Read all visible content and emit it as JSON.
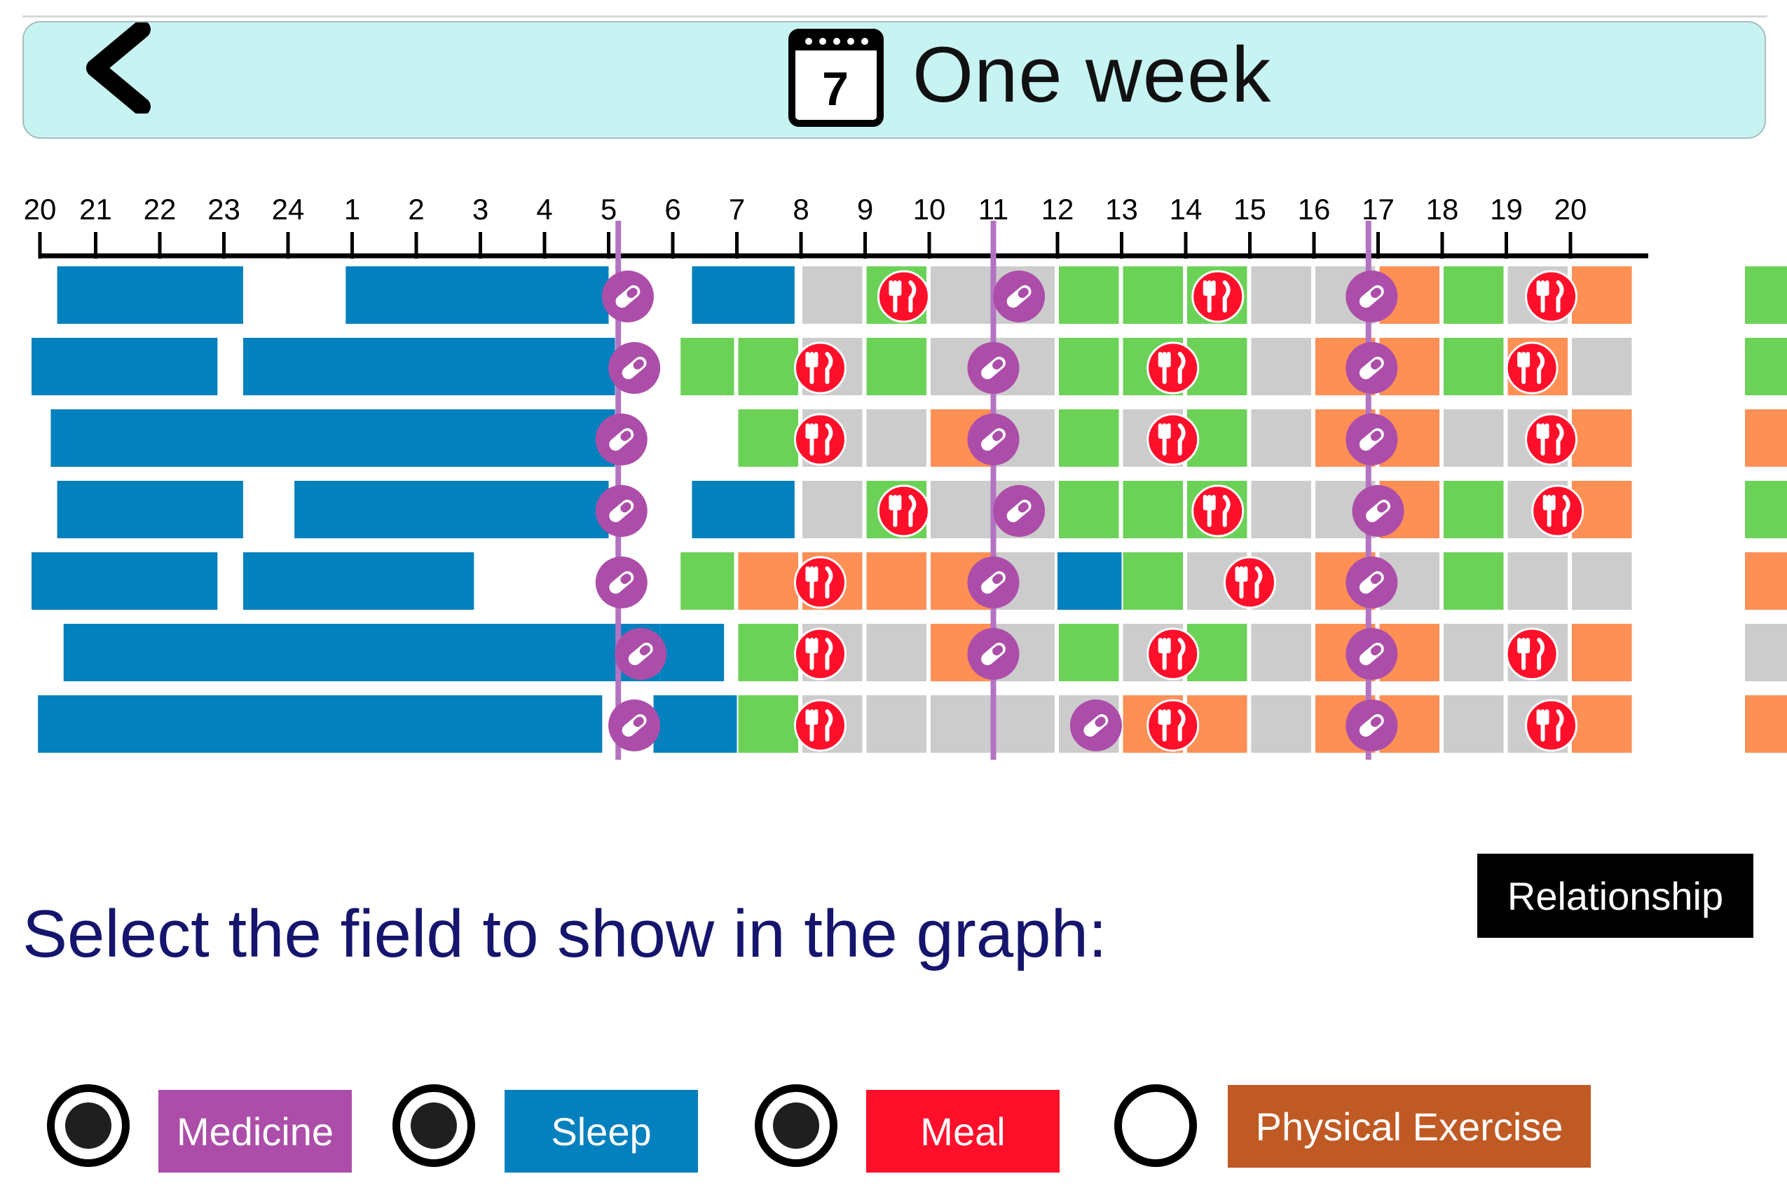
{
  "header": {
    "title": "One week",
    "calendar_day": "7"
  },
  "colors": {
    "sleep": "#0380be",
    "light": "#6bd257",
    "moderate": "#cccccc",
    "exercise": "#fe8f55",
    "medicine": "#ac4ea9",
    "meal": "#ff0f2a",
    "grid": "#000000"
  },
  "chart_data": {
    "type": "timeline",
    "x_ticks": [
      "20",
      "21",
      "22",
      "23",
      "24",
      "1",
      "2",
      "3",
      "4",
      "5",
      "6",
      "7",
      "8",
      "9",
      "10",
      "11",
      "12",
      "13",
      "14",
      "15",
      "16",
      "17",
      "18",
      "19",
      "20"
    ],
    "x_tick_hours": [
      20,
      21,
      22,
      23,
      24,
      25,
      26,
      27,
      28,
      29,
      30,
      31,
      32,
      33,
      34,
      35,
      36,
      37,
      38,
      39,
      40,
      41,
      42,
      43,
      44
    ],
    "medicine_guide_hours": [
      29.15,
      35.0,
      40.85
    ],
    "rows": [
      {
        "sleep": [
          [
            20.4,
            23.3
          ],
          [
            24.9,
            29.0
          ],
          [
            30.3,
            31.9
          ]
        ],
        "activity": [
          [
            "moderate",
            32.0,
            33.0
          ],
          [
            "light",
            33.0,
            34.0
          ],
          [
            "moderate",
            34.0,
            35.0
          ],
          [
            "moderate",
            35.0,
            36.0
          ],
          [
            "light",
            36.0,
            37.0
          ],
          [
            "light",
            37.0,
            38.0
          ],
          [
            "light",
            38.0,
            39.0
          ],
          [
            "moderate",
            39.0,
            40.0
          ],
          [
            "moderate",
            40.0,
            41.0
          ],
          [
            "exercise",
            41.0,
            42.0
          ],
          [
            "light",
            42.0,
            43.0
          ],
          [
            "moderate",
            43.0,
            44.0
          ],
          [
            "exercise",
            44.0,
            45.0
          ],
          [
            "light",
            46.7,
            47.6
          ]
        ],
        "medicine": [
          29.3,
          35.4,
          40.9
        ],
        "meal": [
          33.6,
          38.5,
          43.7
        ]
      },
      {
        "sleep": [
          [
            20.0,
            22.9
          ],
          [
            23.3,
            29.1
          ]
        ],
        "activity": [
          [
            "light",
            30.1,
            31.0
          ],
          [
            "light",
            31.0,
            32.0
          ],
          [
            "moderate",
            32.0,
            33.0
          ],
          [
            "light",
            33.0,
            34.0
          ],
          [
            "moderate",
            34.0,
            35.0
          ],
          [
            "moderate",
            35.0,
            36.0
          ],
          [
            "light",
            36.0,
            37.0
          ],
          [
            "light",
            37.0,
            38.0
          ],
          [
            "light",
            38.0,
            39.0
          ],
          [
            "moderate",
            39.0,
            40.0
          ],
          [
            "exercise",
            40.0,
            41.0
          ],
          [
            "exercise",
            41.0,
            42.0
          ],
          [
            "light",
            42.0,
            43.0
          ],
          [
            "exercise",
            43.0,
            44.0
          ],
          [
            "moderate",
            44.0,
            45.0
          ],
          [
            "light",
            46.7,
            47.6
          ]
        ],
        "medicine": [
          29.4,
          35.0,
          40.9
        ],
        "meal": [
          32.3,
          37.8,
          43.4
        ]
      },
      {
        "sleep": [
          [
            20.3,
            29.1
          ]
        ],
        "activity": [
          [
            "light",
            31.0,
            32.0
          ],
          [
            "moderate",
            32.0,
            33.0
          ],
          [
            "moderate",
            33.0,
            34.0
          ],
          [
            "exercise",
            34.0,
            35.0
          ],
          [
            "moderate",
            35.0,
            36.0
          ],
          [
            "light",
            36.0,
            37.0
          ],
          [
            "moderate",
            37.0,
            38.0
          ],
          [
            "light",
            38.0,
            39.0
          ],
          [
            "moderate",
            39.0,
            40.0
          ],
          [
            "exercise",
            40.0,
            41.0
          ],
          [
            "exercise",
            41.0,
            42.0
          ],
          [
            "moderate",
            42.0,
            43.0
          ],
          [
            "moderate",
            43.0,
            44.0
          ],
          [
            "exercise",
            44.0,
            45.0
          ],
          [
            "exercise",
            46.7,
            47.6
          ]
        ],
        "medicine": [
          29.2,
          35.0,
          40.9
        ],
        "meal": [
          32.3,
          37.8,
          43.7
        ]
      },
      {
        "sleep": [
          [
            20.4,
            23.3
          ],
          [
            24.1,
            29.0
          ],
          [
            30.3,
            31.9
          ]
        ],
        "activity": [
          [
            "moderate",
            32.0,
            33.0
          ],
          [
            "light",
            33.0,
            34.0
          ],
          [
            "moderate",
            34.0,
            35.0
          ],
          [
            "moderate",
            35.0,
            36.0
          ],
          [
            "light",
            36.0,
            37.0
          ],
          [
            "light",
            37.0,
            38.0
          ],
          [
            "light",
            38.0,
            39.0
          ],
          [
            "moderate",
            39.0,
            40.0
          ],
          [
            "moderate",
            40.0,
            41.0
          ],
          [
            "exercise",
            41.0,
            42.0
          ],
          [
            "light",
            42.0,
            43.0
          ],
          [
            "moderate",
            43.0,
            44.0
          ],
          [
            "exercise",
            44.0,
            45.0
          ],
          [
            "light",
            46.7,
            47.6
          ]
        ],
        "medicine": [
          29.2,
          35.4,
          41.0
        ],
        "meal": [
          33.6,
          38.5,
          43.8
        ]
      },
      {
        "sleep": [
          [
            20.0,
            22.9
          ],
          [
            23.3,
            26.9
          ],
          [
            36.0,
            37.0
          ]
        ],
        "activity": [
          [
            "light",
            30.1,
            31.0
          ],
          [
            "exercise",
            31.0,
            32.0
          ],
          [
            "exercise",
            32.0,
            33.0
          ],
          [
            "exercise",
            33.0,
            34.0
          ],
          [
            "exercise",
            34.0,
            35.0
          ],
          [
            "moderate",
            35.0,
            36.0
          ],
          [
            "light",
            37.0,
            38.0
          ],
          [
            "moderate",
            38.0,
            39.0
          ],
          [
            "moderate",
            39.0,
            40.0
          ],
          [
            "exercise",
            40.0,
            41.0
          ],
          [
            "moderate",
            41.0,
            42.0
          ],
          [
            "light",
            42.0,
            43.0
          ],
          [
            "moderate",
            43.0,
            44.0
          ],
          [
            "moderate",
            44.0,
            45.0
          ],
          [
            "exercise",
            46.7,
            47.6
          ]
        ],
        "medicine": [
          29.2,
          35.0,
          40.9
        ],
        "meal": [
          32.3,
          39.0
        ]
      },
      {
        "sleep": [
          [
            20.5,
            29.8
          ],
          [
            29.8,
            30.8
          ]
        ],
        "activity": [
          [
            "light",
            31.0,
            32.0
          ],
          [
            "moderate",
            32.0,
            33.0
          ],
          [
            "moderate",
            33.0,
            34.0
          ],
          [
            "exercise",
            34.0,
            35.0
          ],
          [
            "moderate",
            35.0,
            36.0
          ],
          [
            "light",
            36.0,
            37.0
          ],
          [
            "moderate",
            37.0,
            38.0
          ],
          [
            "light",
            38.0,
            39.0
          ],
          [
            "moderate",
            39.0,
            40.0
          ],
          [
            "exercise",
            40.0,
            41.0
          ],
          [
            "exercise",
            41.0,
            42.0
          ],
          [
            "moderate",
            42.0,
            43.0
          ],
          [
            "moderate",
            43.0,
            44.0
          ],
          [
            "exercise",
            44.0,
            45.0
          ],
          [
            "moderate",
            46.7,
            47.6
          ]
        ],
        "medicine": [
          29.5,
          35.0,
          40.9
        ],
        "meal": [
          32.3,
          37.8,
          43.4
        ]
      },
      {
        "sleep": [
          [
            20.1,
            28.9
          ],
          [
            29.7,
            31.0
          ]
        ],
        "activity": [
          [
            "light",
            31.0,
            32.0
          ],
          [
            "moderate",
            32.0,
            33.0
          ],
          [
            "moderate",
            33.0,
            34.0
          ],
          [
            "moderate",
            34.0,
            35.0
          ],
          [
            "moderate",
            35.0,
            36.0
          ],
          [
            "moderate",
            36.0,
            37.0
          ],
          [
            "exercise",
            37.0,
            38.0
          ],
          [
            "exercise",
            38.0,
            39.0
          ],
          [
            "moderate",
            39.0,
            40.0
          ],
          [
            "exercise",
            40.0,
            41.0
          ],
          [
            "exercise",
            41.0,
            42.0
          ],
          [
            "moderate",
            42.0,
            43.0
          ],
          [
            "moderate",
            43.0,
            44.0
          ],
          [
            "exercise",
            44.0,
            45.0
          ],
          [
            "exercise",
            46.7,
            47.6
          ]
        ],
        "medicine": [
          29.4,
          36.6,
          40.9
        ],
        "meal": [
          32.3,
          37.8,
          43.7
        ]
      }
    ]
  },
  "relationship_button": "Relationship",
  "prompt": "Select the field to show in the graph:",
  "options": [
    {
      "label": "Medicine",
      "selected": true,
      "color": "#ac4ea9"
    },
    {
      "label": "Sleep",
      "selected": true,
      "color": "#0380be"
    },
    {
      "label": "Meal",
      "selected": true,
      "color": "#ff0f2a"
    },
    {
      "label": "Physical Exercise",
      "selected": false,
      "color": "#c05a24"
    }
  ]
}
